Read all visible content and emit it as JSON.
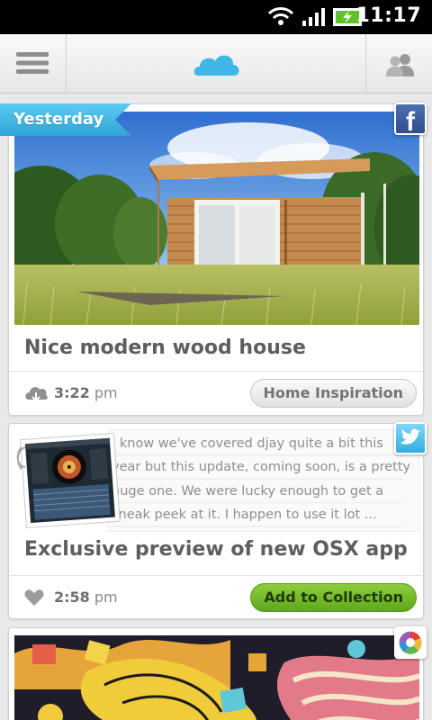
{
  "status_bar": {
    "time": "11:17"
  },
  "app_bar": {
    "icons": [
      "menu-icon",
      "cloud-logo-icon",
      "people-icon"
    ]
  },
  "section_label": "Yesterday",
  "colors": {
    "accent_blue": "#3fb6e8",
    "button_green": "#6cb52a",
    "title_gray": "#5e5e5e"
  },
  "cards": [
    {
      "source_icon": "facebook-icon",
      "title": "Nice modern wood house",
      "time_value": "3:22",
      "time_suffix": "pm",
      "action_label": "Home Inspiration",
      "action_style": "gray",
      "footer_icon": "cloud-download-icon"
    },
    {
      "source_icon": "twitter-icon",
      "excerpt_lines": [
        "I know we've covered djay quite a bit this",
        "year but this update, coming soon, is a pretty",
        "huge one. We were lucky enough to get a",
        "sneak peek at it. I happen to use it lot ..."
      ],
      "title": "Exclusive preview of new OSX app",
      "time_value": "2:58",
      "time_suffix": "pm",
      "action_label": "Add to Collection",
      "action_style": "green",
      "footer_icon": "heart-icon"
    },
    {
      "source_icon": "picasa-icon"
    }
  ]
}
